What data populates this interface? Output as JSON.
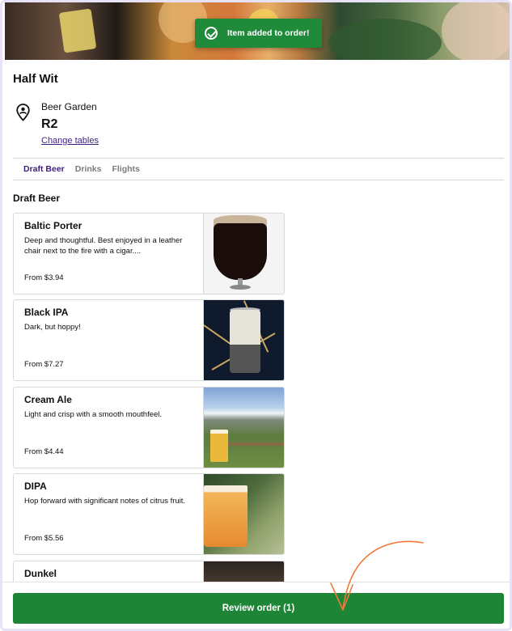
{
  "toast": {
    "message": "Item added to order!",
    "icon": "check-circle-icon"
  },
  "venue": {
    "name": "Half Wit"
  },
  "location": {
    "icon": "location-pin-icon",
    "area": "Beer Garden",
    "table": "R2",
    "change_link": "Change tables"
  },
  "tabs": [
    {
      "label": "Draft Beer",
      "active": true
    },
    {
      "label": "Drinks",
      "active": false
    },
    {
      "label": "Flights",
      "active": false
    }
  ],
  "section": {
    "title": "Draft Beer"
  },
  "items": [
    {
      "name": "Baltic Porter",
      "description": "Deep and thoughtful. Best enjoyed in a leather chair next to the fire with a cigar....",
      "price": "From $3.94"
    },
    {
      "name": "Black IPA",
      "description": "Dark, but hoppy!",
      "price": "From $7.27"
    },
    {
      "name": "Cream Ale",
      "description": "Light and crisp with a smooth mouthfeel.",
      "price": "From $4.44"
    },
    {
      "name": "DIPA",
      "description": "Hop forward with significant notes of citrus fruit.",
      "price": "From $5.56"
    },
    {
      "name": "Dunkel",
      "description": "",
      "price": ""
    }
  ],
  "footer": {
    "review_button": "Review order (1)"
  },
  "colors": {
    "accent_green": "#1e8436",
    "toast_green": "#1f8a3a",
    "link_purple": "#3b1f7a",
    "annotation_orange": "#f07a3c"
  }
}
